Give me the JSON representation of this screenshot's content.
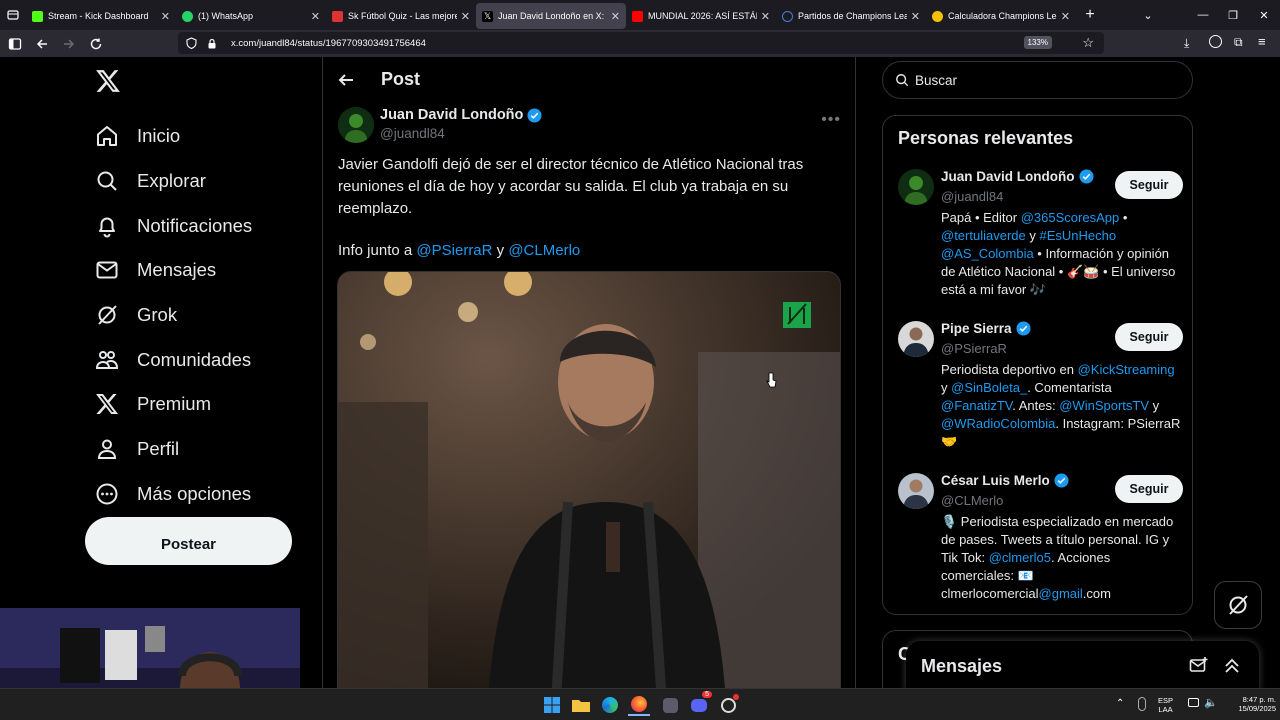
{
  "browser": {
    "tabs": [
      {
        "title": "Stream - Kick Dashboard",
        "color": "#53fc18"
      },
      {
        "title": "(1) WhatsApp",
        "color": "#25d366"
      },
      {
        "title": "Sk Fútbol Quiz - Las mejores pr",
        "color": "#d33"
      },
      {
        "title": "Juan David Londoño en X: \"Javi",
        "color": "#ffffff",
        "active": true
      },
      {
        "title": "MUNDIAL 2026: ASÍ ESTÁN LOS",
        "color": "#ff0000"
      },
      {
        "title": "Partidos de Champions League",
        "color": "#4a7bd8"
      },
      {
        "title": "Calculadora Champions League",
        "color": "#f2c200"
      }
    ],
    "url": "x.com/juandl84/status/1967709303491756464",
    "zoom": "133%"
  },
  "sidebar": {
    "items": [
      {
        "label": "Inicio",
        "icon": "home-icon"
      },
      {
        "label": "Explorar",
        "icon": "search-icon"
      },
      {
        "label": "Notificaciones",
        "icon": "bell-icon"
      },
      {
        "label": "Mensajes",
        "icon": "envelope-icon"
      },
      {
        "label": "Grok",
        "icon": "grok-icon"
      },
      {
        "label": "Comunidades",
        "icon": "people-icon"
      },
      {
        "label": "Premium",
        "icon": "x-logo-icon"
      },
      {
        "label": "Perfil",
        "icon": "person-icon"
      },
      {
        "label": "Más opciones",
        "icon": "more-circle-icon"
      }
    ],
    "post_button": "Postear"
  },
  "post": {
    "header_title": "Post",
    "author_name": "Juan David Londoño",
    "author_handle": "@juandl84",
    "text": "Javier Gandolfi dejó de ser el director técnico de Atlético Nacional tras reuniones el día de hoy y acordar su salida. El club ya trabaja en su reemplazo.",
    "info_prefix": "Info junto a ",
    "mention1": "@PSierraR",
    "info_join": " y ",
    "mention2": "@CLMerlo"
  },
  "right": {
    "search_placeholder": "Buscar",
    "relevant_title": "Personas relevantes",
    "people": [
      {
        "name": "Juan David Londoño",
        "handle": "@juandl84",
        "verified": true,
        "follow": "Seguir",
        "bio": "Papá • Editor @365ScoresApp • @tertuliaverde y #EsUnHecho @AS_Colombia • Información y opinión de Atlético Nacional • 🎸🥁 • El universo está a mi favor 🎶"
      },
      {
        "name": "Pipe Sierra",
        "handle": "@PSierraR",
        "verified": true,
        "follow": "Seguir",
        "bio": "Periodista deportivo en @KickStreaming y @SinBoleta_. Comentarista @FanatizTV. Antes: @WinSportsTV y @WRadioColombia. Instagram: PSierraR 🤝"
      },
      {
        "name": "César Luis Merlo",
        "handle": "@CLMerlo",
        "verified": true,
        "follow": "Seguir",
        "bio": "🎙️ Periodista especializado en mercado de pases. Tweets a título personal. IG y Tik Tok: @clmerlo5. Acciones comerciales: 📧 clmerlocomercial@gmail.com"
      }
    ],
    "next_section_initial": "C",
    "messages_title": "Mensajes"
  },
  "taskbar": {
    "lang": "ESP",
    "region": "LAA",
    "time": "8:47 p. m.",
    "date": "15/09/2025",
    "discord_badge": "5"
  },
  "colors": {
    "accent": "#1d9bf0",
    "background": "#000000",
    "border": "#2f3336"
  }
}
